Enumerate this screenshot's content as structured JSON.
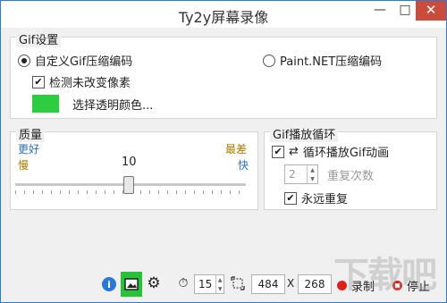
{
  "window": {
    "title": "Ty2y屏幕录像",
    "minimize": "—",
    "maximize": "□",
    "close": "✕"
  },
  "gif_settings": {
    "legend": "Gif设置",
    "custom_encoder_label": "自定义Gif压缩编码",
    "paintnet_encoder_label": "Paint.NET压缩编码",
    "detect_unchanged_label": "检测未改变像素",
    "detect_unchanged_checked": true,
    "transparent_color_label": "选择透明颜色...",
    "transparent_color": "#2ecc40",
    "selected_encoder": "custom"
  },
  "quality": {
    "legend": "质量",
    "better_label": "更好",
    "best_label": "最差",
    "slow_label": "慢",
    "fast_label": "快",
    "value": "10",
    "label_color_blue": "#2b6fb6",
    "label_color_gold": "#a67c00"
  },
  "gif_loop": {
    "legend": "Gif播放循环",
    "loop_label": "循环播放Gif动画",
    "loop_checked": true,
    "repeat_count_value": "2",
    "repeat_count_label": "重复次数",
    "forever_label": "永远重复",
    "forever_checked": true
  },
  "statusbar": {
    "info_icon": "info-icon",
    "image_icon": "image-icon",
    "settings_icon": "gear-icon",
    "timer_icon": "timer-icon",
    "fps_value": "15",
    "size_icon": "resize-icon",
    "width_value": "484",
    "x_label": "X",
    "height_value": "268",
    "record_label": "录制",
    "stop_label": "停止",
    "record_color": "#e0201b"
  },
  "watermark": {
    "text": "下载吧"
  }
}
